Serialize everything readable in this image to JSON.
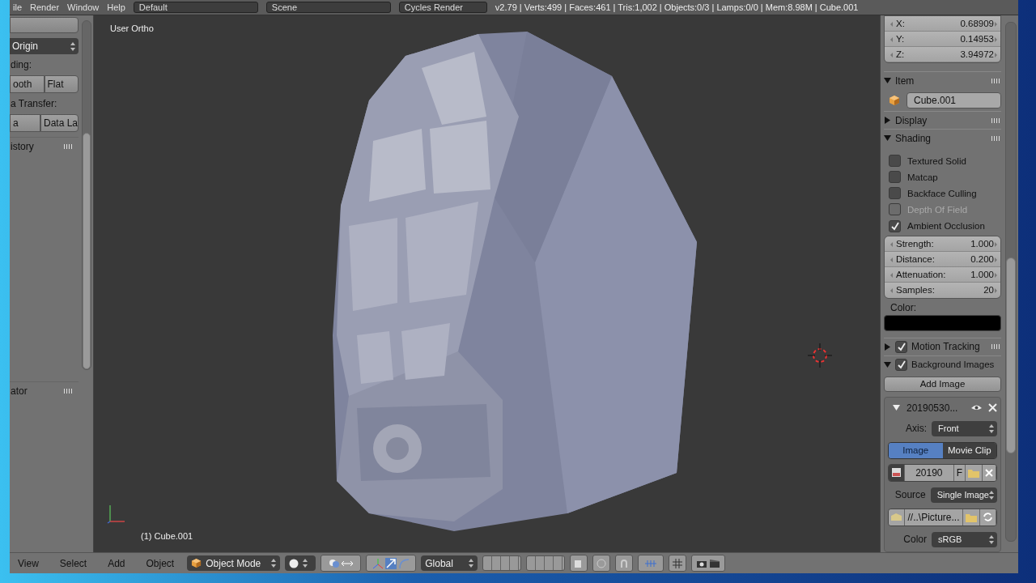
{
  "top_bar": {
    "menus": [
      "ile",
      "Render",
      "Window",
      "Help"
    ],
    "layout": "Default",
    "scene": "Scene",
    "engine": "Cycles Render",
    "stats": "v2.79 | Verts:499 | Faces:461 | Tris:1,002 | Objects:0/3 | Lamps:0/0 | Mem:8.98M | Cube.001"
  },
  "tool_shelf": {
    "origin_select": "Origin",
    "shading_label": "ding:",
    "shading_buttons": [
      "ooth",
      "Flat"
    ],
    "data_transfer_label": "a Transfer:",
    "data_transfer_buttons": [
      "a",
      "Data La"
    ],
    "panels": [
      {
        "title": "istory"
      },
      {
        "title": "ator"
      }
    ]
  },
  "viewport": {
    "view_name": "User Ortho",
    "object_label": "(1) Cube.001"
  },
  "properties": {
    "location": [
      {
        "axis": "X:",
        "value": "0.68909"
      },
      {
        "axis": "Y:",
        "value": "0.14953"
      },
      {
        "axis": "Z:",
        "value": "3.94972"
      }
    ],
    "item": {
      "title": "Item",
      "expanded": true,
      "name": "Cube.001"
    },
    "display": {
      "title": "Display",
      "expanded": false
    },
    "shading": {
      "title": "Shading",
      "expanded": true,
      "options": [
        {
          "label": "Textured Solid",
          "checked": false,
          "disabled": false
        },
        {
          "label": "Matcap",
          "checked": false,
          "disabled": false
        },
        {
          "label": "Backface Culling",
          "checked": false,
          "disabled": false
        },
        {
          "label": "Depth Of Field",
          "checked": false,
          "disabled": true
        },
        {
          "label": "Ambient Occlusion",
          "checked": true,
          "disabled": false
        }
      ],
      "ao_fields": [
        {
          "label": "Strength:",
          "value": "1.000"
        },
        {
          "label": "Distance:",
          "value": "0.200"
        },
        {
          "label": "Attenuation:",
          "value": "1.000"
        },
        {
          "label": "Samples:",
          "value": "20"
        }
      ],
      "color_label": "Color:",
      "color": "#000000"
    },
    "motion_tracking": {
      "title": "Motion Tracking",
      "expanded": false,
      "enabled": true
    },
    "background_images": {
      "title": "Background Images",
      "expanded": true,
      "enabled": true,
      "add_button": "Add Image",
      "image": {
        "name": "20190530...",
        "expanded": true,
        "axis_label": "Axis:",
        "axis": "Front",
        "source_tabs": [
          {
            "label": "Image",
            "selected": true
          },
          {
            "label": "Movie Clip",
            "selected": false
          }
        ],
        "image_id": "20190",
        "fake_user": "F",
        "source_label": "Source",
        "source": "Single Image",
        "filepath": "//..\\Picture...",
        "color_label": "Color",
        "color_space": "sRGB"
      }
    }
  },
  "header": {
    "menus": [
      "View",
      "Select",
      "Add",
      "Object"
    ],
    "mode": "Object Mode",
    "orientation": "Global"
  }
}
